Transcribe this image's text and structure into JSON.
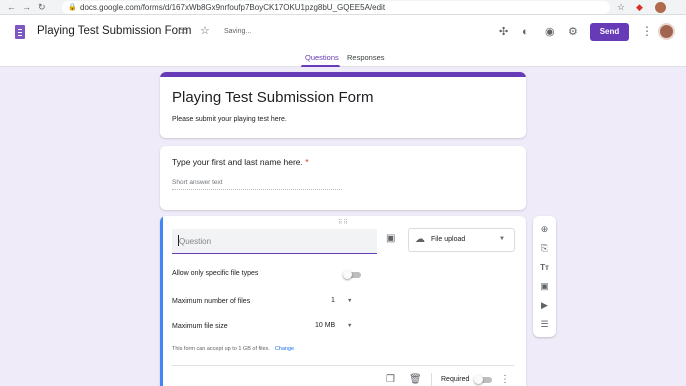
{
  "browser": {
    "back": "←",
    "forward": "→",
    "reload": "↻",
    "url": "docs.google.com/forms/d/167xWb8Gx9nrfoufp7BoyCK17OKU1pzg8bU_GQEE5A/edit"
  },
  "header": {
    "title": "Playing Test Submission Form",
    "status": "Saving...",
    "send_label": "Send"
  },
  "tabs": [
    {
      "label": "Questions",
      "active": true
    },
    {
      "label": "Responses",
      "active": false
    }
  ],
  "form": {
    "title": "Playing Test Submission Form",
    "description": "Please submit your playing test here."
  },
  "question1": {
    "label": "Type your first and last name here.",
    "required_mark": "*",
    "hint": "Short answer text"
  },
  "question2": {
    "placeholder": "Question",
    "type_label": "File upload",
    "allow_specific_label": "Allow only specific file types",
    "allow_specific_on": false,
    "max_files_label": "Maximum number of files",
    "max_files_value": "1",
    "max_size_label": "Maximum file size",
    "max_size_value": "10 MB",
    "note": "This form can accept up to 1 GB of files.",
    "change_link": "Change",
    "required_label": "Required",
    "required_on": false
  },
  "colors": {
    "accent": "#673ab7",
    "background": "#f0ebf8",
    "active_bar": "#4285f4"
  }
}
